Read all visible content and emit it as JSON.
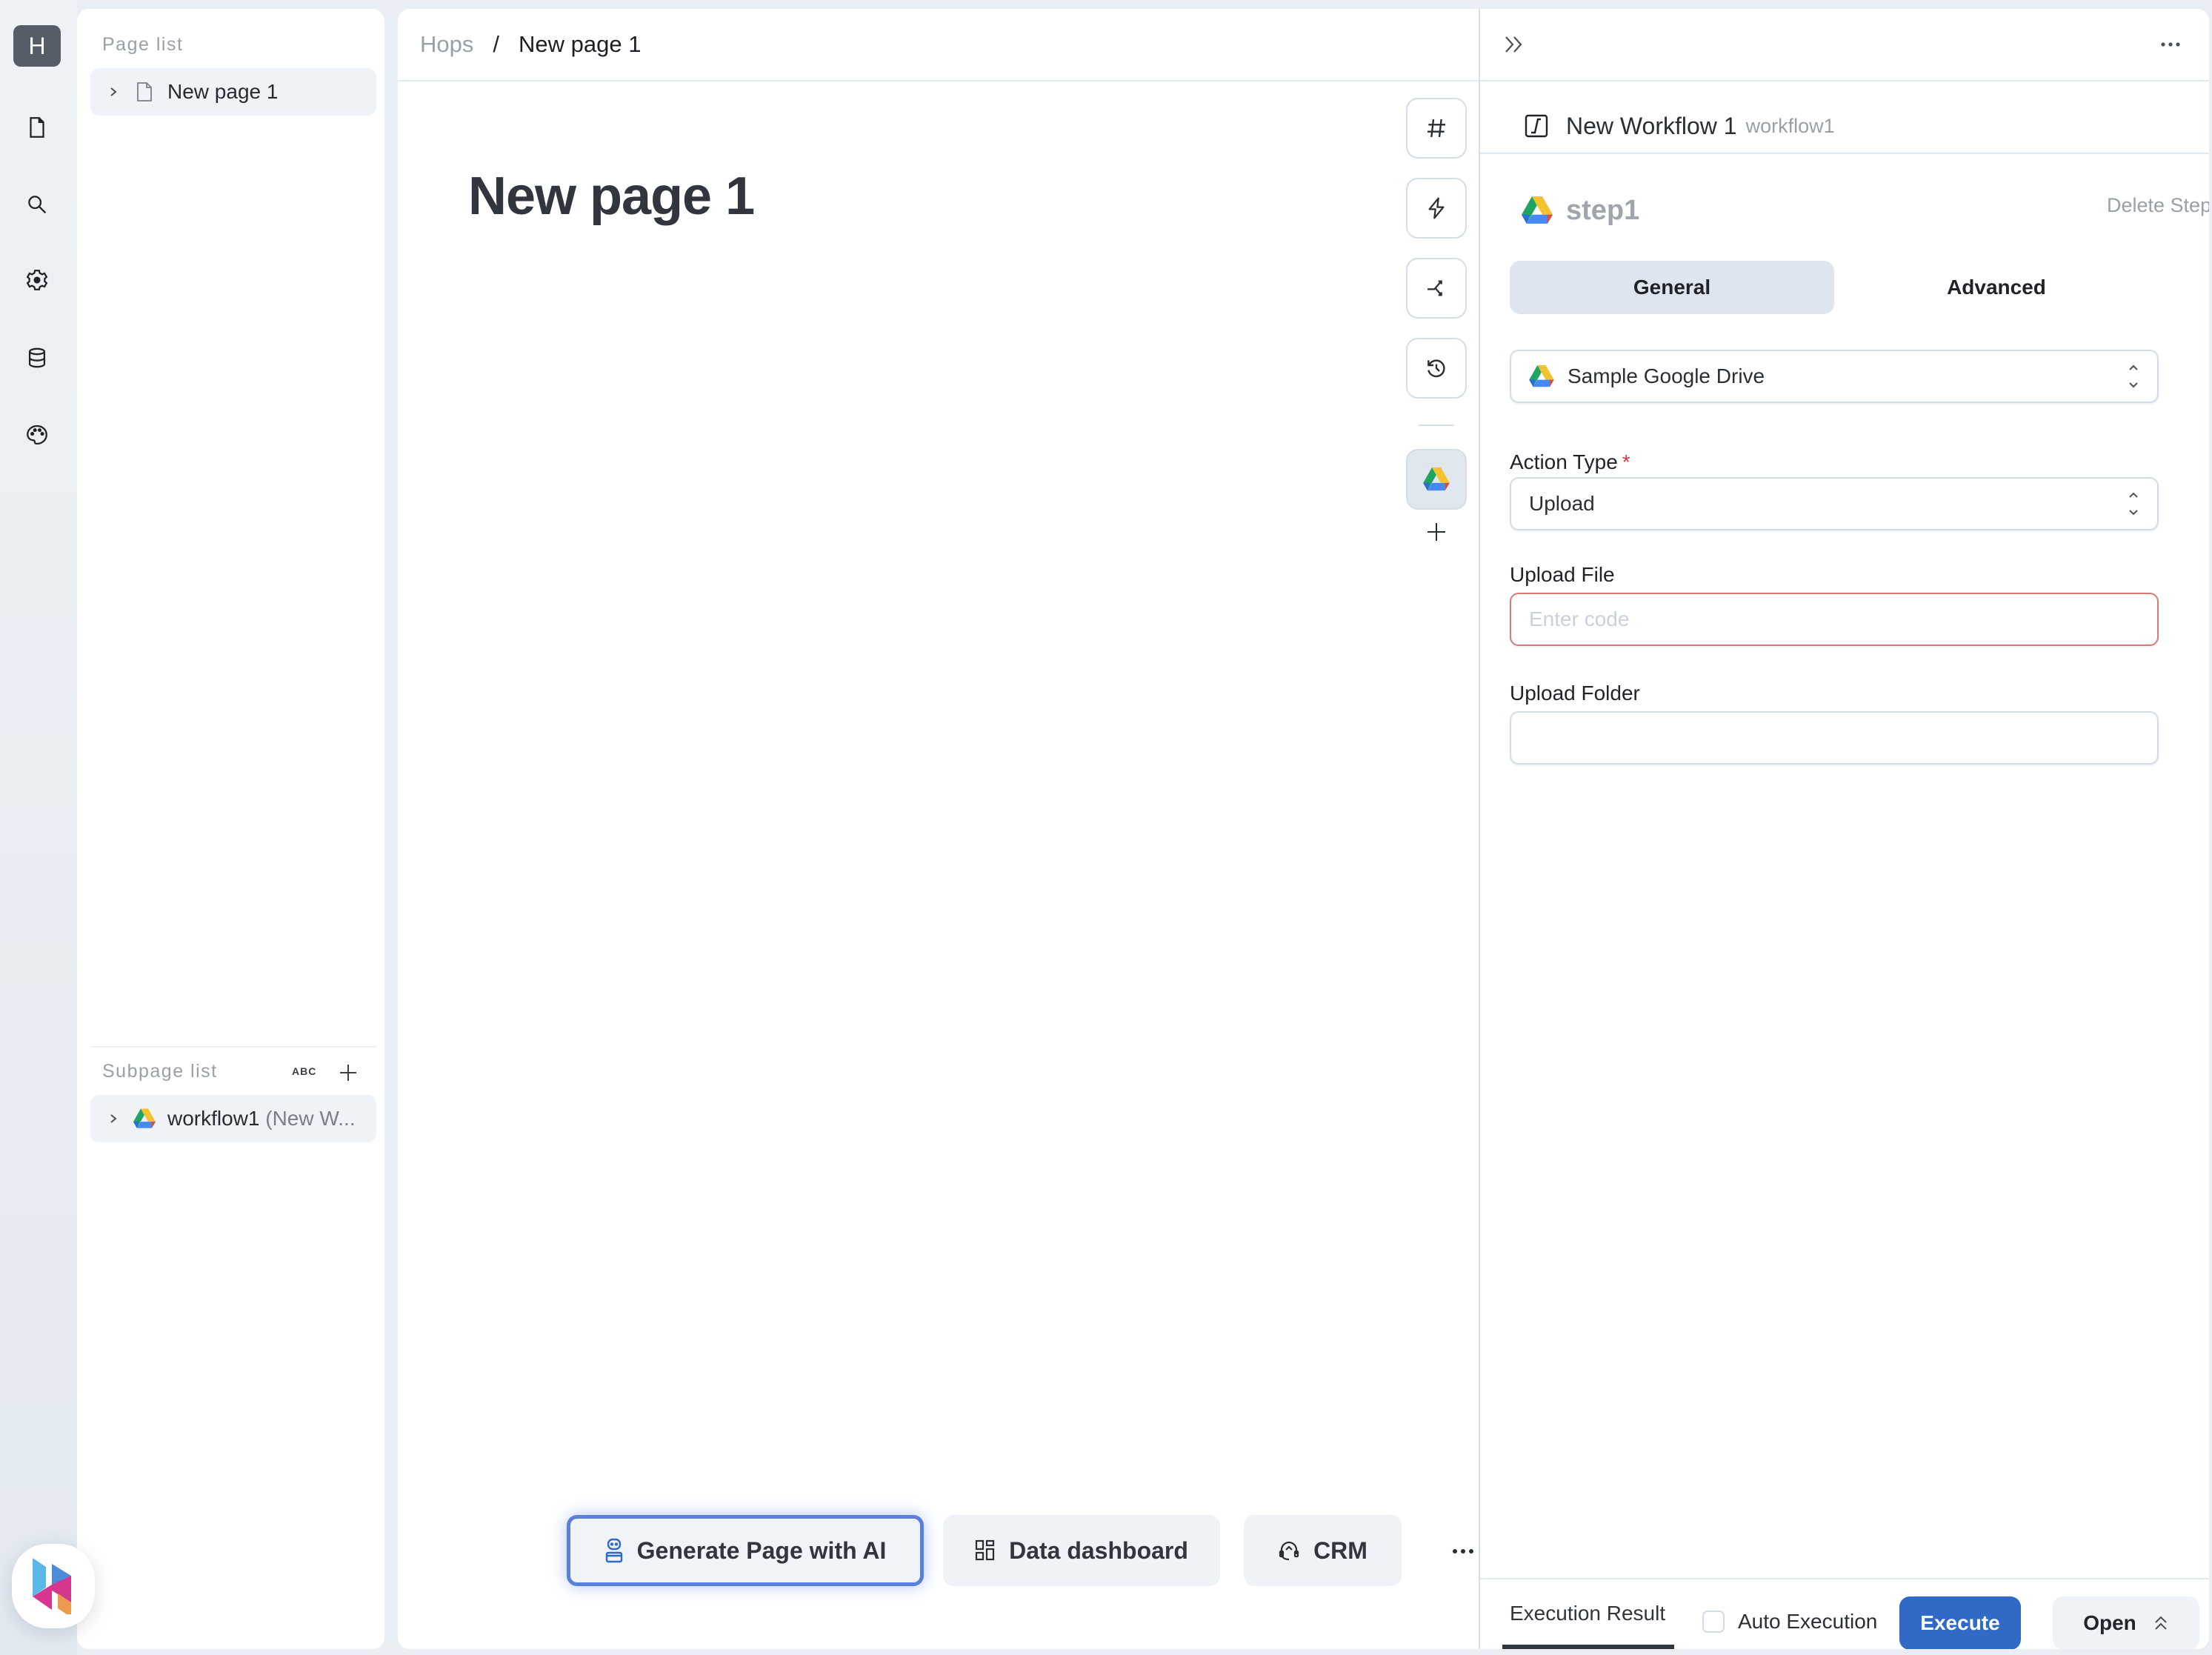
{
  "workspace": {
    "initial": "H"
  },
  "rail": {
    "items": [
      {
        "name": "pages",
        "icon": "file-icon"
      },
      {
        "name": "search",
        "icon": "search-icon"
      },
      {
        "name": "settings",
        "icon": "gear-icon"
      },
      {
        "name": "database",
        "icon": "database-icon"
      },
      {
        "name": "theme",
        "icon": "palette-icon"
      }
    ]
  },
  "left_panel": {
    "page_list_label": "Page list",
    "pages": [
      {
        "label": "New page 1",
        "icon": "file-icon"
      }
    ],
    "subpage_list_label": "Subpage list",
    "sort_label": "ABC",
    "subpages": [
      {
        "label": "workflow1",
        "suffix": "(New W...",
        "icon": "google-drive-icon"
      }
    ]
  },
  "breadcrumb": {
    "root": "Hops",
    "separator": "/",
    "current": "New page 1"
  },
  "page": {
    "title": "New page 1"
  },
  "toolbar": {
    "buttons": [
      {
        "name": "hash",
        "icon": "hash-icon"
      },
      {
        "name": "trigger",
        "icon": "lightning-icon"
      },
      {
        "name": "branch",
        "icon": "shuffle-icon"
      },
      {
        "name": "history",
        "icon": "history-icon"
      }
    ],
    "active_integration": "google-drive-icon"
  },
  "quick_actions": [
    {
      "label": "Generate Page with AI",
      "icon": "ai-robot-icon",
      "highlighted": true
    },
    {
      "label": "Data dashboard",
      "icon": "dashboard-icon",
      "highlighted": false
    },
    {
      "label": "CRM",
      "icon": "headset-icon",
      "highlighted": false
    }
  ],
  "workflow_panel": {
    "title": "New Workflow 1",
    "id": "workflow1",
    "step": {
      "name": "step1",
      "delete_label": "Delete Step"
    },
    "tabs": [
      {
        "label": "General",
        "active": true
      },
      {
        "label": "Advanced",
        "active": false
      }
    ],
    "resource": {
      "value": "Sample Google Drive"
    },
    "action_type": {
      "label": "Action Type",
      "required_mark": "*",
      "value": "Upload"
    },
    "upload_file": {
      "label": "Upload File",
      "placeholder": "Enter code",
      "value": ""
    },
    "upload_folder": {
      "label": "Upload Folder",
      "value": ""
    },
    "footer": {
      "result_tab": "Execution Result",
      "auto_execution_label": "Auto Execution",
      "auto_execution_checked": false,
      "execute_label": "Execute",
      "open_label": "Open"
    }
  },
  "colors": {
    "accent": "#3169c6",
    "error_border": "#d97a76",
    "required": "#d0393a",
    "active_tab": "#dee5ee"
  }
}
